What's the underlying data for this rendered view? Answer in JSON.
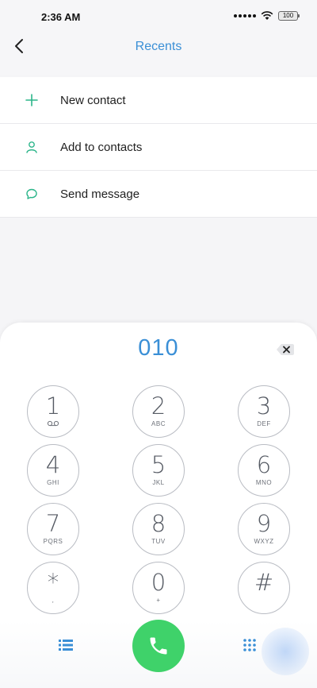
{
  "status_bar": {
    "time": "2:36 AM",
    "battery": "100"
  },
  "header": {
    "title": "Recents",
    "back_icon": "chevron-left-icon"
  },
  "actions": [
    {
      "label": "New contact",
      "icon": "plus-icon"
    },
    {
      "label": "Add to contacts",
      "icon": "person-icon"
    },
    {
      "label": "Send message",
      "icon": "message-bubble-icon"
    }
  ],
  "dialpad": {
    "number": "010",
    "keys": [
      {
        "digit": "1",
        "letters": "◌◌"
      },
      {
        "digit": "2",
        "letters": "ABC"
      },
      {
        "digit": "3",
        "letters": "DEF"
      },
      {
        "digit": "4",
        "letters": "GHI"
      },
      {
        "digit": "5",
        "letters": "JKL"
      },
      {
        "digit": "6",
        "letters": "MNO"
      },
      {
        "digit": "7",
        "letters": "PQRS"
      },
      {
        "digit": "8",
        "letters": "TUV"
      },
      {
        "digit": "9",
        "letters": "WXYZ"
      },
      {
        "digit": "*",
        "letters": ","
      },
      {
        "digit": "0",
        "letters": "+"
      },
      {
        "digit": "#",
        "letters": ""
      }
    ]
  },
  "colors": {
    "accent": "#3a8fd6",
    "action_icon": "#2cb58a",
    "call": "#3fd26a"
  }
}
